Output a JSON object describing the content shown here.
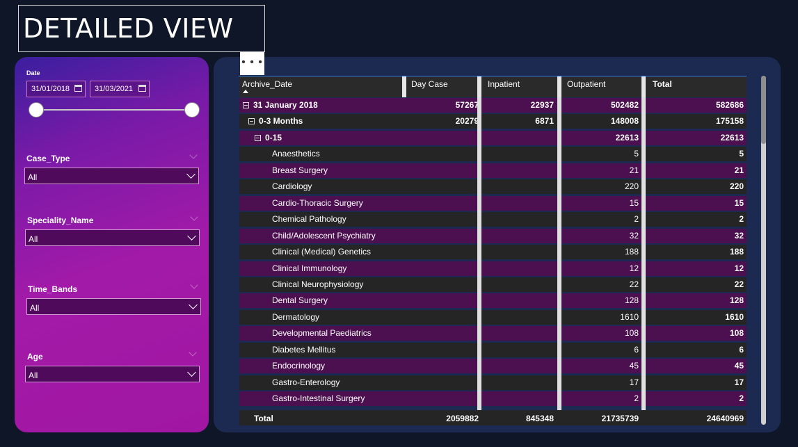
{
  "page_title": "DETAILED VIEW",
  "more_options_label": "• • •",
  "filters": {
    "date": {
      "label": "Date",
      "start": "31/01/2018",
      "end": "31/03/2021"
    },
    "case_type": {
      "label": "Case_Type",
      "value": "All"
    },
    "speciality_name": {
      "label": "Speciality_Name",
      "value": "All"
    },
    "time_bands": {
      "label": "Time_Bands",
      "value": "All"
    },
    "age": {
      "label": "Age",
      "value": "All"
    }
  },
  "table": {
    "columns": [
      "Archive_Date",
      "Day Case",
      "Inpatient",
      "Outpatient",
      "Total"
    ],
    "rows": [
      {
        "label": "31 January 2018",
        "level": 0,
        "expand": true,
        "bold": true,
        "day_case": "57267",
        "inpatient": "22937",
        "outpatient": "502482",
        "total": "582686"
      },
      {
        "label": "0-3 Months",
        "level": 1,
        "expand": true,
        "bold": true,
        "day_case": "20279",
        "inpatient": "6871",
        "outpatient": "148008",
        "total": "175158"
      },
      {
        "label": "0-15",
        "level": 2,
        "expand": true,
        "bold": true,
        "day_case": "",
        "inpatient": "",
        "outpatient": "22613",
        "total": "22613"
      },
      {
        "label": "Anaesthetics",
        "level": 3,
        "day_case": "",
        "inpatient": "",
        "outpatient": "5",
        "total": "5"
      },
      {
        "label": "Breast Surgery",
        "level": 3,
        "day_case": "",
        "inpatient": "",
        "outpatient": "21",
        "total": "21"
      },
      {
        "label": "Cardiology",
        "level": 3,
        "day_case": "",
        "inpatient": "",
        "outpatient": "220",
        "total": "220"
      },
      {
        "label": "Cardio-Thoracic Surgery",
        "level": 3,
        "day_case": "",
        "inpatient": "",
        "outpatient": "15",
        "total": "15"
      },
      {
        "label": "Chemical Pathology",
        "level": 3,
        "day_case": "",
        "inpatient": "",
        "outpatient": "2",
        "total": "2"
      },
      {
        "label": "Child/Adolescent Psychiatry",
        "level": 3,
        "day_case": "",
        "inpatient": "",
        "outpatient": "32",
        "total": "32"
      },
      {
        "label": "Clinical (Medical) Genetics",
        "level": 3,
        "day_case": "",
        "inpatient": "",
        "outpatient": "188",
        "total": "188"
      },
      {
        "label": "Clinical Immunology",
        "level": 3,
        "day_case": "",
        "inpatient": "",
        "outpatient": "12",
        "total": "12"
      },
      {
        "label": "Clinical Neurophysiology",
        "level": 3,
        "day_case": "",
        "inpatient": "",
        "outpatient": "22",
        "total": "22"
      },
      {
        "label": "Dental Surgery",
        "level": 3,
        "day_case": "",
        "inpatient": "",
        "outpatient": "128",
        "total": "128"
      },
      {
        "label": "Dermatology",
        "level": 3,
        "day_case": "",
        "inpatient": "",
        "outpatient": "1610",
        "total": "1610"
      },
      {
        "label": "Developmental Paediatrics",
        "level": 3,
        "day_case": "",
        "inpatient": "",
        "outpatient": "108",
        "total": "108"
      },
      {
        "label": "Diabetes Mellitus",
        "level": 3,
        "day_case": "",
        "inpatient": "",
        "outpatient": "6",
        "total": "6"
      },
      {
        "label": "Endocrinology",
        "level": 3,
        "day_case": "",
        "inpatient": "",
        "outpatient": "45",
        "total": "45"
      },
      {
        "label": "Gastro-Enterology",
        "level": 3,
        "day_case": "",
        "inpatient": "",
        "outpatient": "17",
        "total": "17"
      },
      {
        "label": "Gastro-Intestinal Surgery",
        "level": 3,
        "day_case": "",
        "inpatient": "",
        "outpatient": "2",
        "total": "2"
      }
    ],
    "totals": {
      "label": "Total",
      "day_case": "2059882",
      "inpatient": "845348",
      "outpatient": "21735739",
      "total": "24640969"
    }
  },
  "colors": {
    "background": "#0f1628",
    "row_purple": "#4c0f4f",
    "row_dark": "#252525",
    "accent_line": "#2f7fe0"
  }
}
